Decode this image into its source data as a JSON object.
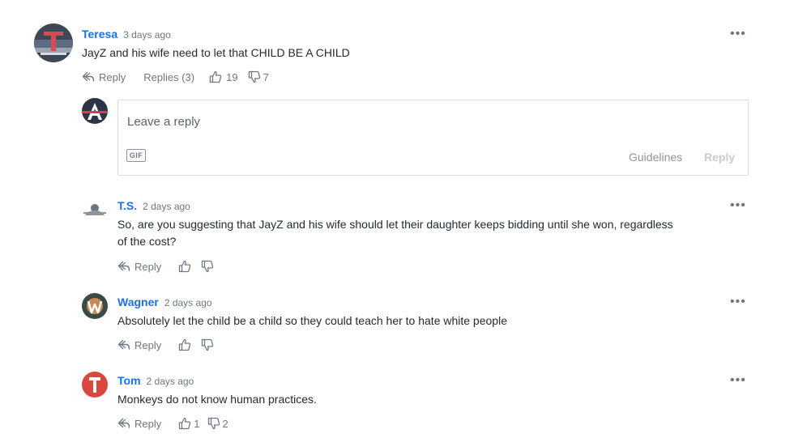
{
  "comment": {
    "author": "Teresa",
    "time": "3 days ago",
    "text": "JayZ and his wife need to let that CHILD BE A CHILD",
    "reply_label": "Reply",
    "replies_label": "Replies (3)",
    "likes": "19",
    "dislikes": "7",
    "more": "•••"
  },
  "reply_form": {
    "placeholder": "Leave a reply",
    "gif_label": "GIF",
    "guidelines_label": "Guidelines",
    "submit_label": "Reply"
  },
  "replies": [
    {
      "author": "T.S.",
      "time": "2 days ago",
      "text_line1": "So, are you suggesting that JayZ and his wife should let their daughter keeps bidding until she won, regardless",
      "text_line2": "of the cost?",
      "reply_label": "Reply",
      "likes": "",
      "dislikes": "",
      "more": "•••"
    },
    {
      "author": "Wagner",
      "time": "2 days ago",
      "text": "Absolutely let the child be a child so they could teach her to hate white people",
      "reply_label": "Reply",
      "likes": "",
      "dislikes": "",
      "more": "•••"
    },
    {
      "author": "Tom",
      "time": "2 days ago",
      "text": "Monkeys do not know human practices.",
      "reply_label": "Reply",
      "likes": "1",
      "dislikes": "2",
      "more": "•••"
    }
  ],
  "colors": {
    "author_link": "#1d6fe0",
    "muted_text": "#6e7780",
    "border": "#dadde1"
  },
  "icons": [
    "reply-arrow-icon",
    "thumbs-up-icon",
    "thumbs-down-icon",
    "more-dots-icon",
    "gif-icon"
  ]
}
